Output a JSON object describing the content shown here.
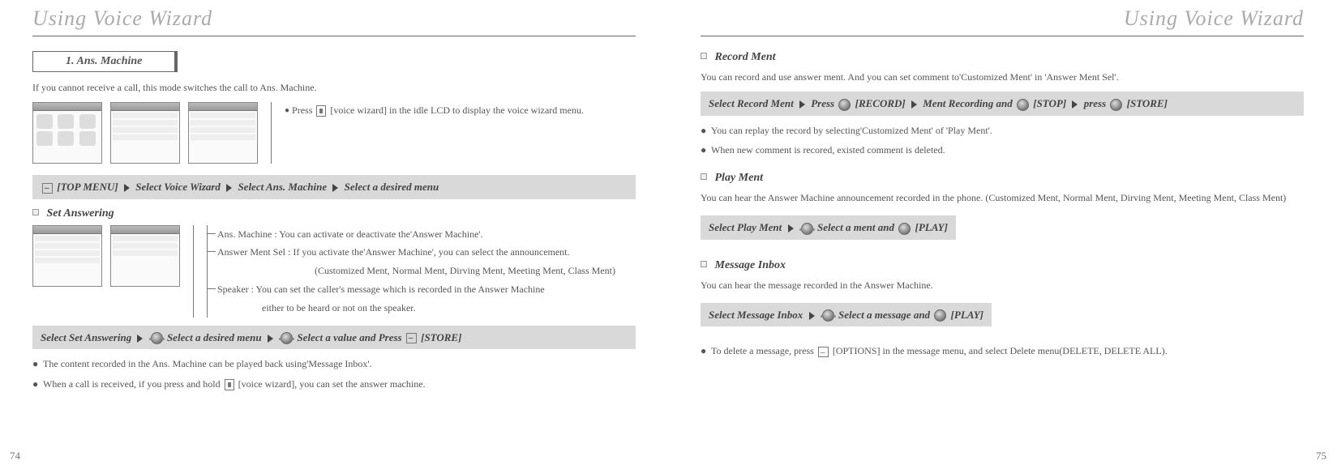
{
  "left": {
    "title": "Using Voice Wizard",
    "section_tab": "1. Ans. Machine",
    "intro": "If you cannot receive a call, this mode switches the call to Ans. Machine.",
    "press_note_pre": "Press ",
    "press_note_post": "[voice wizard] in the idle LCD to display the voice wizard menu.",
    "step_bar_1": {
      "pre": "[TOP MENU]",
      "p2": "Select Voice Wizard",
      "p3": "Select Ans. Machine",
      "p4": "Select a desired menu"
    },
    "sub_set_answering": "Set Answering",
    "tree": {
      "t1": "Ans. Machine : You can activate or deactivate the'Answer Machine'.",
      "t2": "Answer Ment Sel : If you activate the'Answer Machine', you can select the announcement.",
      "t2b": "(Customized Ment, Normal Ment, Dirving Ment, Meeting Ment, Class Ment)",
      "t3": "Speaker : You can set the caller's message which is recorded in the Answer Machine",
      "t3b": "either to be heard or not on the speaker."
    },
    "step_bar_2": {
      "p1": "Select Set Answering",
      "p2": " Select a desired menu",
      "p3": " Select a value and Press ",
      "p3b": "[STORE]"
    },
    "bul1": "The content recorded in the Ans. Machine can be played back using'Message Inbox'.",
    "bul2_pre": "When a call is received, if you press and hold",
    "bul2_post": "[voice wizard], you can set the answer machine.",
    "page_num": "74"
  },
  "right": {
    "title": "Using Voice Wizard",
    "sub_record": "Record Ment",
    "record_desc": "You can record and use answer ment. And you can set comment to'Customized Ment' in 'Answer Ment Sel'.",
    "step_record": {
      "p1": "Select Record Ment",
      "p2": "Press ",
      "p2b": "[RECORD]",
      "p3": "Ment Recording and ",
      "p3b": "[STOP]",
      "p4": "press ",
      "p4b": "[STORE]"
    },
    "rec_bul1": "You can replay the record by selecting'Customized Ment' of 'Play Ment'.",
    "rec_bul2": "When new comment is recored, existed comment is deleted.",
    "sub_play": "Play Ment",
    "play_desc": "You can hear the Answer Machine announcement recorded in the phone. (Customized Ment, Normal Ment, Dirving Ment, Meeting Ment, Class Ment)",
    "step_play": {
      "p1": "Select Play Ment",
      "p2": "Select a ment and ",
      "p2b": "[PLAY]"
    },
    "sub_inbox": "Message Inbox",
    "inbox_desc": "You can hear the message recorded in the Answer Machine.",
    "step_inbox": {
      "p1": "Select Message Inbox",
      "p2": "Select a message and ",
      "p2b": "[PLAY]"
    },
    "inbox_bul_pre": "To delete a message, press ",
    "inbox_bul_post": "[OPTIONS] in the message menu, and select Delete menu(DELETE, DELETE ALL).",
    "page_num": "75"
  }
}
